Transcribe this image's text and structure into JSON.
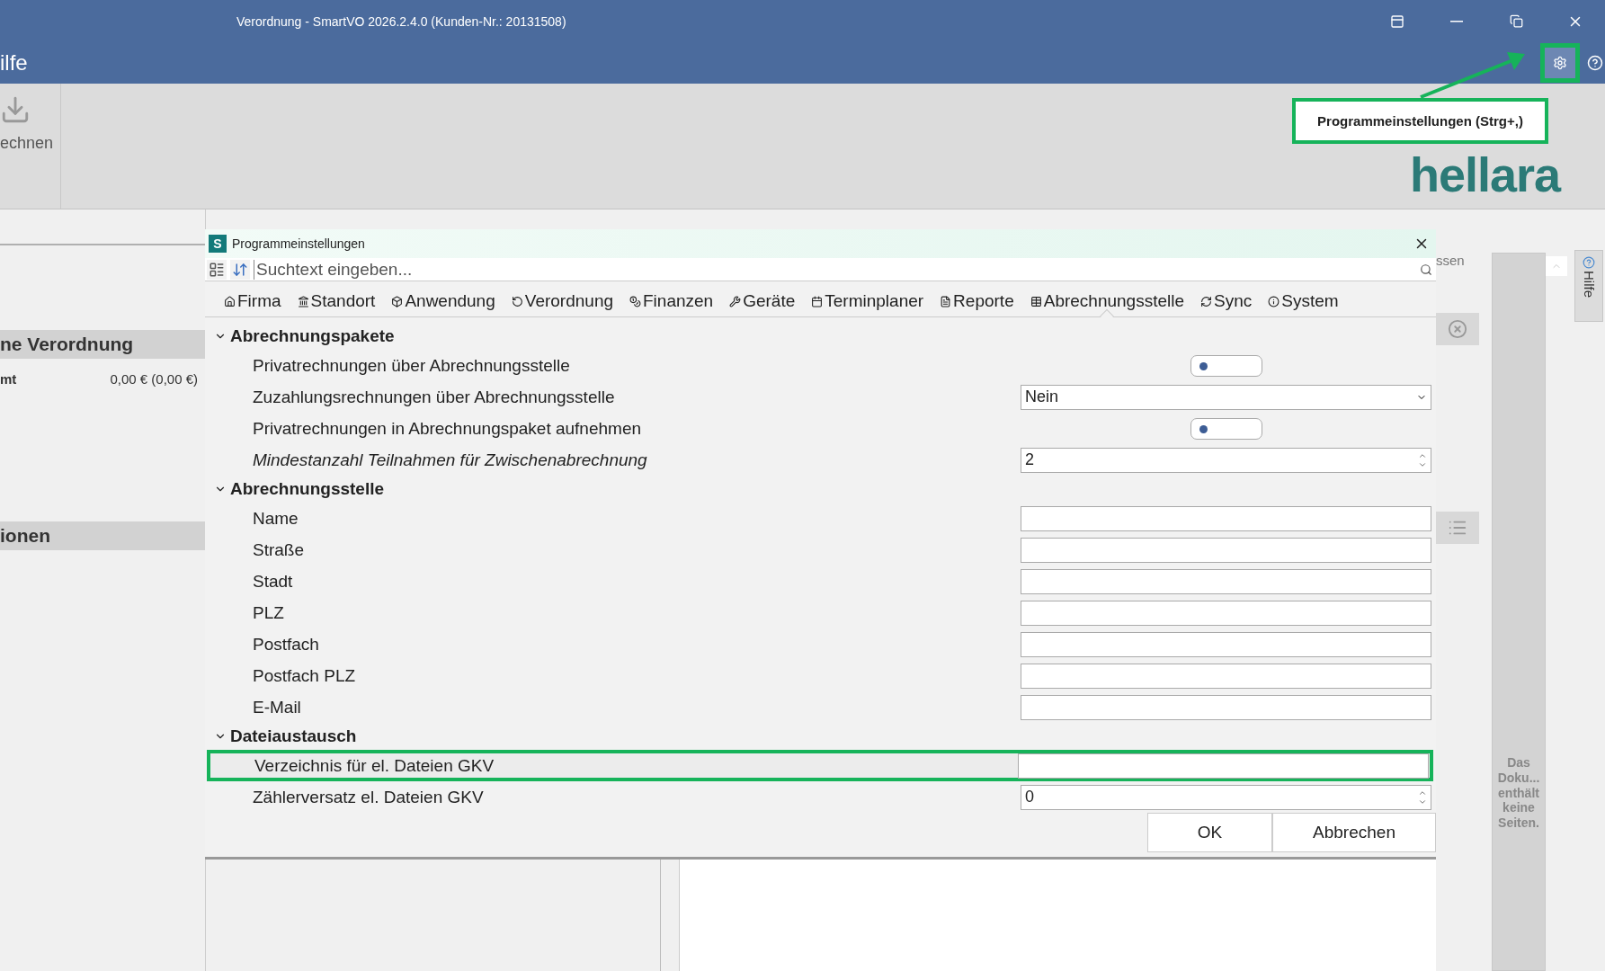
{
  "window": {
    "title": "Verordnung - SmartVO 2026.2.4.0 (Kunden-Nr.: 20131508)"
  },
  "menu_bar": {
    "partial_label": "ilfe",
    "settings_highlighted": true
  },
  "ribbon": {
    "button_label": "echnen",
    "logo": "hellara"
  },
  "tooltip": {
    "text": "Programmeinstellungen (Strg+,)"
  },
  "left_panel": {
    "sections": [
      {
        "title": "ne Verordnung",
        "rows": [
          {
            "label": "mt",
            "value": "0,00 € (0,00 €)"
          }
        ]
      },
      {
        "title": "ionen"
      }
    ]
  },
  "right_panel": {
    "partial_label": "ssen",
    "document_message": "Das Doku... enthält keine Seiten.",
    "side_tab": "Hilfe"
  },
  "dialog": {
    "title": "Programmeinstellungen",
    "app_icon": "S",
    "search": {
      "placeholder": "Suchtext eingeben..."
    },
    "tabs": [
      {
        "label": "Firma",
        "selected": false
      },
      {
        "label": "Standort",
        "selected": false
      },
      {
        "label": "Anwendung",
        "selected": false
      },
      {
        "label": "Verordnung",
        "selected": false
      },
      {
        "label": "Finanzen",
        "selected": false
      },
      {
        "label": "Geräte",
        "selected": false
      },
      {
        "label": "Terminplaner",
        "selected": false
      },
      {
        "label": "Reporte",
        "selected": false
      },
      {
        "label": "Abrechnungsstelle",
        "selected": true
      },
      {
        "label": "Sync",
        "selected": false
      },
      {
        "label": "System",
        "selected": false
      }
    ],
    "groups": [
      {
        "title": "Abrechnungspakete",
        "expanded": true,
        "rows": [
          {
            "label": "Privatrechnungen über Abrechnungsstelle",
            "kind": "toggle",
            "on": false,
            "italic": false,
            "highlighted": false
          },
          {
            "label": "Zuzahlungsrechnungen über Abrechnungsstelle",
            "kind": "dropdown",
            "value": "Nein",
            "italic": false,
            "highlighted": false
          },
          {
            "label": "Privatrechnungen in Abrechnungspaket aufnehmen",
            "kind": "toggle",
            "on": false,
            "italic": false,
            "highlighted": false
          },
          {
            "label": "Mindestanzahl Teilnahmen für Zwischenabrechnung",
            "kind": "spinner",
            "value": "2",
            "italic": true,
            "highlighted": false
          }
        ]
      },
      {
        "title": "Abrechnungsstelle",
        "expanded": true,
        "rows": [
          {
            "label": "Name",
            "kind": "text",
            "italic": false,
            "highlighted": false
          },
          {
            "label": "Straße",
            "kind": "text",
            "italic": false,
            "highlighted": false
          },
          {
            "label": "Stadt",
            "kind": "text",
            "italic": false,
            "highlighted": false
          },
          {
            "label": "PLZ",
            "kind": "text",
            "italic": false,
            "highlighted": false
          },
          {
            "label": "Postfach",
            "kind": "text",
            "italic": false,
            "highlighted": false
          },
          {
            "label": "Postfach PLZ",
            "kind": "text",
            "italic": false,
            "highlighted": false
          },
          {
            "label": "E-Mail",
            "kind": "text",
            "italic": false,
            "highlighted": false
          }
        ]
      },
      {
        "title": "Dateiaustausch",
        "expanded": true,
        "rows": [
          {
            "label": "Verzeichnis für el. Dateien GKV",
            "kind": "text",
            "italic": false,
            "highlighted": true
          },
          {
            "label": "Zählerversatz el. Dateien GKV",
            "kind": "spinner",
            "value": "0",
            "italic": false,
            "highlighted": false
          }
        ]
      }
    ],
    "buttons": [
      "OK",
      "Abbrechen"
    ]
  }
}
